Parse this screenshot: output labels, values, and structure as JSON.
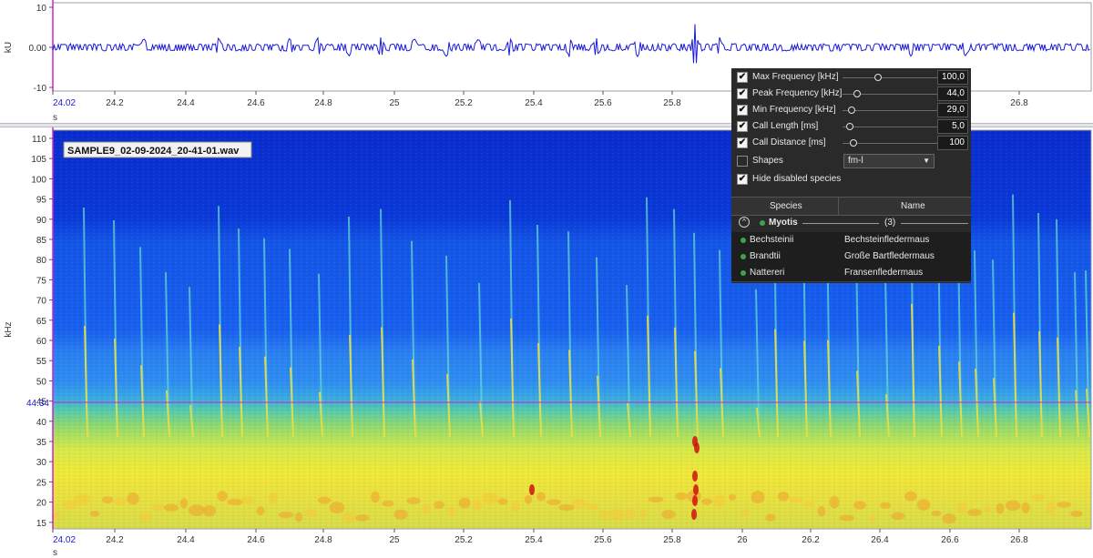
{
  "waveform": {
    "unit_label": "kU",
    "y_ticks": [
      "10",
      "0.00",
      "-10"
    ],
    "x_ticks": [
      "24.02",
      "24.2",
      "24.4",
      "24.6",
      "24.8",
      "25",
      "25.2",
      "25.4",
      "25.6",
      "25.8",
      "26",
      "26.2",
      "26.4",
      "26.6",
      "26.8"
    ],
    "x_unit": "s",
    "color": "#1a1ad6"
  },
  "spectrogram": {
    "file_label": "SAMPLE9_02-09-2024_20-41-01.wav",
    "unit_label": "kHz",
    "y_ticks": [
      "110",
      "105",
      "100",
      "95",
      "90",
      "85",
      "80",
      "75",
      "70",
      "65",
      "60",
      "55",
      "50",
      "45",
      "40",
      "35",
      "30",
      "25",
      "20",
      "15"
    ],
    "marker_value": "44.34",
    "marker_color": "#d020d0",
    "x_ticks": [
      "24.02",
      "24.2",
      "24.4",
      "24.6",
      "24.8",
      "25",
      "25.2",
      "25.4",
      "25.6",
      "25.8",
      "26",
      "26.2",
      "26.4",
      "26.6",
      "26.8"
    ],
    "x_unit": "s"
  },
  "panel": {
    "params": [
      {
        "label": "Max Frequency [kHz]",
        "value": "100,0",
        "checked": true,
        "level": 0.42
      },
      {
        "label": "Peak Frequency [kHz]",
        "value": "44,0",
        "checked": true,
        "level": 0.18
      },
      {
        "label": "Min Frequency [kHz]",
        "value": "29,0",
        "checked": true,
        "level": 0.1
      },
      {
        "label": "Call Length [ms]",
        "value": "5,0",
        "checked": true,
        "level": 0.08
      },
      {
        "label": "Call Distance [ms]",
        "value": "100",
        "checked": true,
        "level": 0.14
      }
    ],
    "shapes": {
      "label": "Shapes",
      "value": "fm-l",
      "checked": false
    },
    "hide_disabled": {
      "label": "Hide disabled species",
      "checked": true
    },
    "columns": {
      "species": "Species",
      "name": "Name"
    },
    "group": {
      "name": "Myotis",
      "count": "(3)"
    },
    "species": [
      {
        "species": "Bechsteinii",
        "name": "Bechsteinfledermaus"
      },
      {
        "species": "Brandtii",
        "name": "Große Bartfledermaus"
      },
      {
        "species": "Nattereri",
        "name": "Fransenfledermaus"
      }
    ]
  }
}
